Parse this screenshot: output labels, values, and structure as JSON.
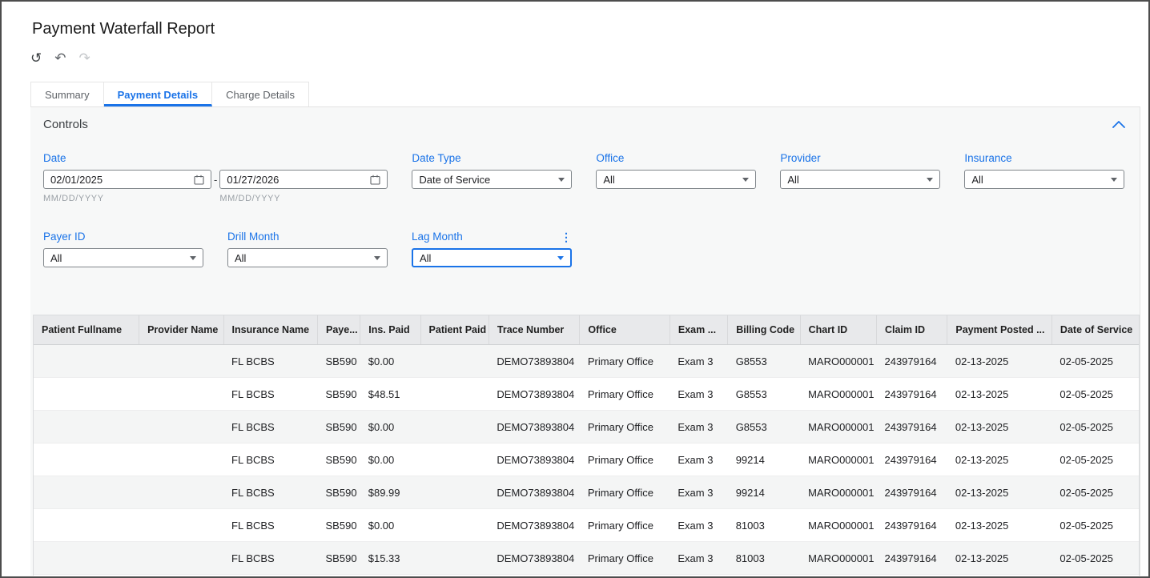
{
  "page": {
    "title": "Payment Waterfall Report"
  },
  "toolbar": {
    "reset_glyph": "↺",
    "undo_glyph": "↶",
    "redo_glyph": "↷"
  },
  "tabs": [
    {
      "label": "Summary",
      "active": false
    },
    {
      "label": "Payment Details",
      "active": true
    },
    {
      "label": "Charge Details",
      "active": false
    }
  ],
  "controls": {
    "title": "Controls",
    "kebab_glyph": "⋮",
    "filters": {
      "date": {
        "label": "Date",
        "start": "02/01/2025",
        "end": "01/27/2026",
        "separator": "-",
        "format_hint": "MM/DD/YYYY"
      },
      "date_type": {
        "label": "Date Type",
        "value": "Date of Service"
      },
      "office": {
        "label": "Office",
        "value": "All"
      },
      "provider": {
        "label": "Provider",
        "value": "All"
      },
      "insurance": {
        "label": "Insurance",
        "value": "All"
      },
      "payer_id": {
        "label": "Payer ID",
        "value": "All"
      },
      "drill_month": {
        "label": "Drill Month",
        "value": "All"
      },
      "lag_month": {
        "label": "Lag Month",
        "value": "All"
      }
    }
  },
  "table": {
    "columns": [
      "Patient Fullname",
      "Provider Name",
      "Insurance Name",
      "Paye...",
      "Ins. Paid",
      "Patient Paid",
      "Trace Number",
      "Office",
      "Exam ...",
      "Billing Code",
      "Chart ID",
      "Claim ID",
      "Payment Posted ...",
      "Date of Service"
    ],
    "rows": [
      [
        "",
        "",
        "FL BCBS",
        "SB590",
        "$0.00",
        "",
        "DEMO73893804",
        "Primary Office",
        "Exam 3",
        "G8553",
        "MARO000001",
        "243979164",
        "02-13-2025",
        "02-05-2025"
      ],
      [
        "",
        "",
        "FL BCBS",
        "SB590",
        "$48.51",
        "",
        "DEMO73893804",
        "Primary Office",
        "Exam 3",
        "G8553",
        "MARO000001",
        "243979164",
        "02-13-2025",
        "02-05-2025"
      ],
      [
        "",
        "",
        "FL BCBS",
        "SB590",
        "$0.00",
        "",
        "DEMO73893804",
        "Primary Office",
        "Exam 3",
        "G8553",
        "MARO000001",
        "243979164",
        "02-13-2025",
        "02-05-2025"
      ],
      [
        "",
        "",
        "FL BCBS",
        "SB590",
        "$0.00",
        "",
        "DEMO73893804",
        "Primary Office",
        "Exam 3",
        "99214",
        "MARO000001",
        "243979164",
        "02-13-2025",
        "02-05-2025"
      ],
      [
        "",
        "",
        "FL BCBS",
        "SB590",
        "$89.99",
        "",
        "DEMO73893804",
        "Primary Office",
        "Exam 3",
        "99214",
        "MARO000001",
        "243979164",
        "02-13-2025",
        "02-05-2025"
      ],
      [
        "",
        "",
        "FL BCBS",
        "SB590",
        "$0.00",
        "",
        "DEMO73893804",
        "Primary Office",
        "Exam 3",
        "81003",
        "MARO000001",
        "243979164",
        "02-13-2025",
        "02-05-2025"
      ],
      [
        "",
        "",
        "FL BCBS",
        "SB590",
        "$15.33",
        "",
        "DEMO73893804",
        "Primary Office",
        "Exam 3",
        "81003",
        "MARO000001",
        "243979164",
        "02-13-2025",
        "02-05-2025"
      ]
    ]
  }
}
